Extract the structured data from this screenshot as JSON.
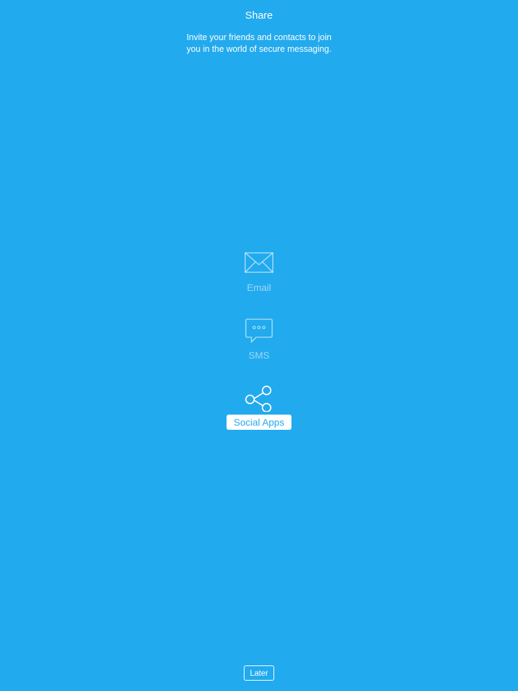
{
  "header": {
    "title": "Share",
    "subtitle_line1": "Invite your friends and contacts to join",
    "subtitle_line2": "you in the world of secure messaging."
  },
  "options": [
    {
      "label": "Email",
      "icon": "envelope-icon",
      "selected": false
    },
    {
      "label": "SMS",
      "icon": "chat-bubble-icon",
      "selected": false
    },
    {
      "label": "Social Apps",
      "icon": "share-icon",
      "selected": true
    }
  ],
  "footer": {
    "later_label": "Later"
  },
  "colors": {
    "background": "#22aaee",
    "foreground": "#ffffff"
  }
}
